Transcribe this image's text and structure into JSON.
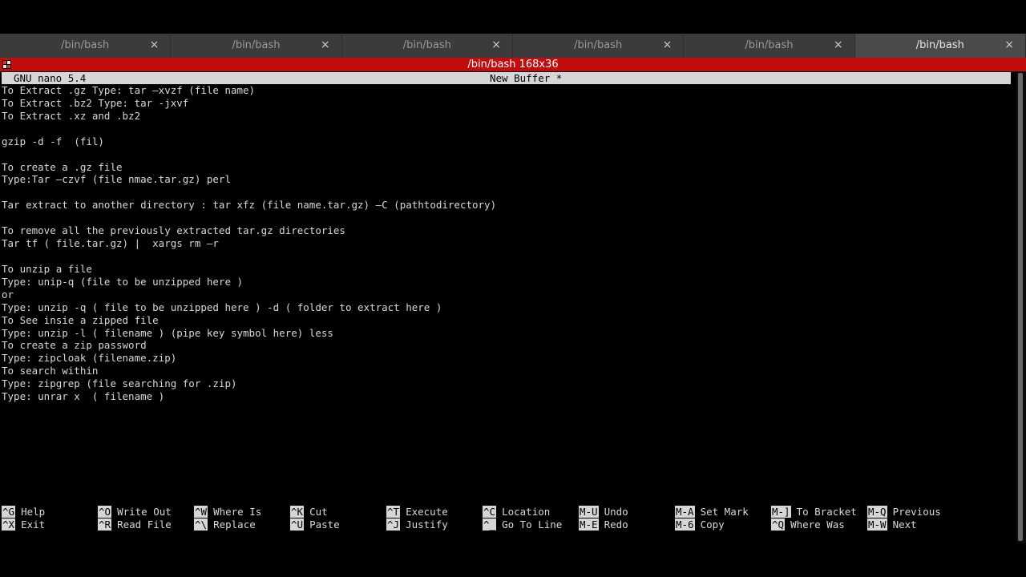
{
  "tabs": [
    {
      "title": "/bin/bash",
      "close": "×"
    },
    {
      "title": "/bin/bash",
      "close": "×"
    },
    {
      "title": "/bin/bash",
      "close": "×"
    },
    {
      "title": "/bin/bash",
      "close": "×"
    },
    {
      "title": "/bin/bash",
      "close": "×"
    },
    {
      "title": "/bin/bash",
      "close": "×"
    }
  ],
  "window": {
    "title": "/bin/bash 168x36",
    "accent": "#c10d0d"
  },
  "nano": {
    "version": "GNU nano 5.4",
    "buffer": "New Buffer *"
  },
  "editor_lines": [
    "To Extract .gz Type: tar –xvzf (file name)",
    "To Extract .bz2 Type: tar -jxvf",
    "To Extract .xz and .bz2",
    "",
    "gzip -d -f  (fil)",
    "",
    "To create a .gz file",
    "Type:Tar –czvf (file nmae.tar.gz) perl",
    "",
    "Tar extract to another directory : tar xfz (file name.tar.gz) –C (pathtodirectory)",
    "",
    "To remove all the previously extracted tar.gz directories",
    "Tar tf ( file.tar.gz) |  xargs rm –r",
    "",
    "To unzip a file",
    "Type: unip-q (file to be unzipped here )",
    "or",
    "Type: unzip -q ( file to be unzipped here ) -d ( folder to extract here )",
    "To See insie a zipped file",
    "Type: unzip -l ( filename ) (pipe key symbol here) less",
    "To create a zip password",
    "Type: zipcloak (filename.zip)",
    "To search within",
    "Type: zipgrep (file searching for .zip)",
    "Type: unrar x  ( filename )"
  ],
  "shortcuts": [
    [
      {
        "key": "^G",
        "label": "Help"
      },
      {
        "key": "^X",
        "label": "Exit"
      }
    ],
    [
      {
        "key": "^O",
        "label": "Write Out"
      },
      {
        "key": "^R",
        "label": "Read File"
      }
    ],
    [
      {
        "key": "^W",
        "label": "Where Is"
      },
      {
        "key": "^\\",
        "label": "Replace"
      }
    ],
    [
      {
        "key": "^K",
        "label": "Cut"
      },
      {
        "key": "^U",
        "label": "Paste"
      }
    ],
    [
      {
        "key": "^T",
        "label": "Execute"
      },
      {
        "key": "^J",
        "label": "Justify"
      }
    ],
    [
      {
        "key": "^C",
        "label": "Location"
      },
      {
        "key": "^_",
        "label": "Go To Line"
      }
    ],
    [
      {
        "key": "M-U",
        "label": "Undo"
      },
      {
        "key": "M-E",
        "label": "Redo"
      }
    ],
    [
      {
        "key": "M-A",
        "label": "Set Mark"
      },
      {
        "key": "M-6",
        "label": "Copy"
      }
    ],
    [
      {
        "key": "M-]",
        "label": "To Bracket"
      },
      {
        "key": "^Q",
        "label": "Where Was"
      }
    ],
    [
      {
        "key": "M-Q",
        "label": "Previous"
      },
      {
        "key": "M-W",
        "label": "Next"
      }
    ]
  ]
}
